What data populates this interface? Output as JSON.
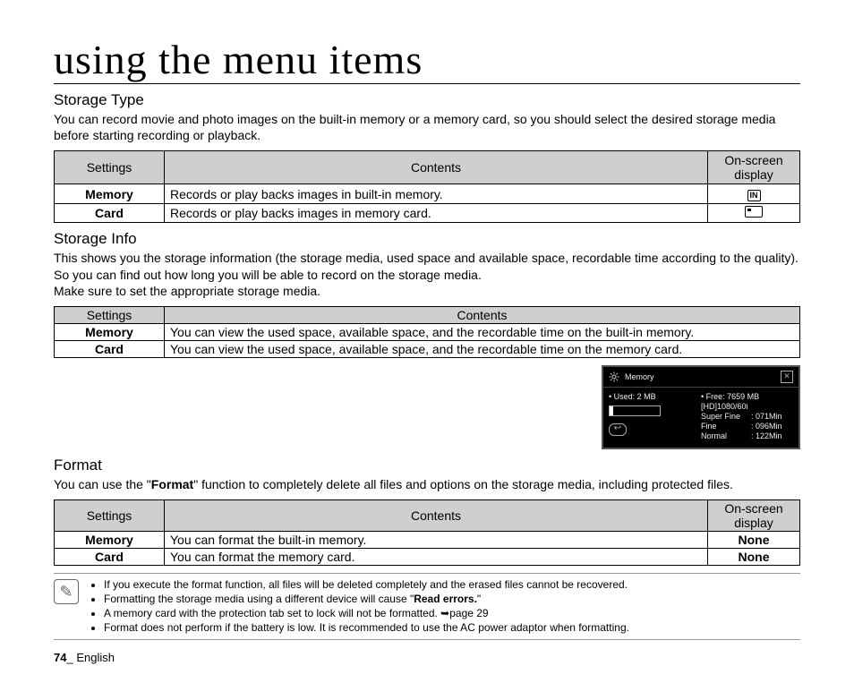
{
  "page": {
    "title": "using the menu items",
    "number": "74",
    "footer_lang": "English"
  },
  "storage_type": {
    "heading": "Storage Type",
    "intro": "You can record movie and photo images on the built-in memory or a memory card, so you should select the desired storage media before starting recording or playback.",
    "headers": {
      "settings": "Settings",
      "contents": "Contents",
      "display": "On-screen display"
    },
    "rows": [
      {
        "setting": "Memory",
        "content": "Records or play backs images in built-in memory.",
        "icon": "IN"
      },
      {
        "setting": "Card",
        "content": "Records or play backs images in memory card.",
        "icon": "card"
      }
    ]
  },
  "storage_info": {
    "heading": "Storage Info",
    "intro": "This shows you the storage information (the storage media, used space and available space, recordable time according to the quality). So you can find out how long you will be able to record on the storage media.\nMake sure to set the appropriate storage media.",
    "headers": {
      "settings": "Settings",
      "contents": "Contents"
    },
    "rows": [
      {
        "setting": "Memory",
        "content": "You can view the used space, available space, and the recordable time on the built-in memory."
      },
      {
        "setting": "Card",
        "content": "You can view the used space, available space, and the recordable time on the memory card."
      }
    ]
  },
  "osd": {
    "title": "Memory",
    "used_label": "• Used:  2  MB",
    "free_label": "• Free:  7659  MB",
    "mode": "[HD]1080/60i",
    "lines": [
      {
        "k": "Super Fine",
        "v": ": 071Min"
      },
      {
        "k": "Fine",
        "v": ": 096Min"
      },
      {
        "k": "Normal",
        "v": ": 122Min"
      }
    ]
  },
  "format": {
    "heading": "Format",
    "intro_pre": "You can use the \"",
    "intro_bold": "Format",
    "intro_post": "\" function to completely delete all files and options on the storage media, including protected files.",
    "headers": {
      "settings": "Settings",
      "contents": "Contents",
      "display": "On-screen display"
    },
    "rows": [
      {
        "setting": "Memory",
        "content": "You can format the built-in memory.",
        "display": "None"
      },
      {
        "setting": "Card",
        "content": "You can format the memory card.",
        "display": "None"
      }
    ]
  },
  "notes": {
    "n1": "If you execute the format function, all files will be deleted completely and the erased files cannot be recovered.",
    "n2_pre": "Formatting the storage media using a different device will cause \"",
    "n2_bold": "Read errors.",
    "n2_post": "\"",
    "n3": "A memory card with the protection tab set to lock will not be formatted. ➥page 29",
    "n4": "Format does not perform if the battery is low. It is recommended to use the AC power adaptor when formatting."
  }
}
